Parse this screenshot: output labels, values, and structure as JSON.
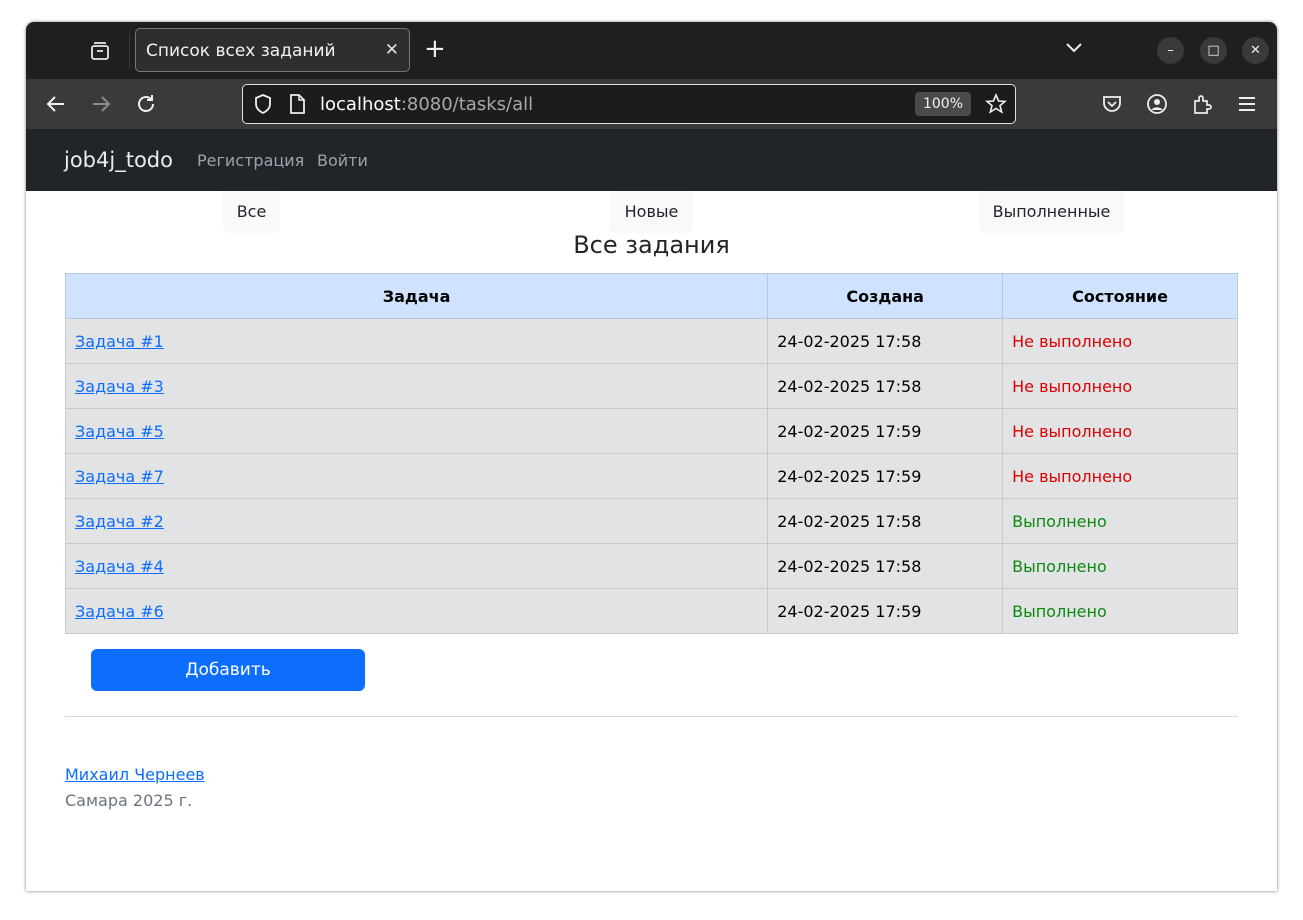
{
  "browser": {
    "tab_title": "Список всех заданий",
    "tab_close": "✕",
    "new_tab": "+",
    "url_host": "localhost",
    "url_rest": ":8080/tasks/all",
    "zoom": "100%",
    "window_controls": {
      "minimize": "–",
      "maximize": "□",
      "close": "✕"
    }
  },
  "navbar": {
    "brand": "job4j_todo",
    "links": [
      "Регистрация",
      "Войти"
    ]
  },
  "filters": [
    "Все",
    "Новые",
    "Выполненные"
  ],
  "page_title": "Все задания",
  "table": {
    "headers": [
      "Задача",
      "Создана",
      "Состояние"
    ],
    "rows": [
      {
        "name": "Задача #1",
        "created": "24-02-2025 17:58",
        "status": "Не выполнено"
      },
      {
        "name": "Задача #3",
        "created": "24-02-2025 17:58",
        "status": "Не выполнено"
      },
      {
        "name": "Задача #5",
        "created": "24-02-2025 17:59",
        "status": "Не выполнено"
      },
      {
        "name": "Задача #7",
        "created": "24-02-2025 17:59",
        "status": "Не выполнено"
      },
      {
        "name": "Задача #2",
        "created": "24-02-2025 17:58",
        "status": "Выполнено"
      },
      {
        "name": "Задача #4",
        "created": "24-02-2025 17:58",
        "status": "Выполнено"
      },
      {
        "name": "Задача #6",
        "created": "24-02-2025 17:59",
        "status": "Выполнено"
      }
    ]
  },
  "add_button": "Добавить",
  "footer": {
    "author": "Михаил Чернеев",
    "place": "Самара 2025 г."
  },
  "colors": {
    "status_not_done": "#dc0000",
    "status_done": "#0d8a0d",
    "primary": "#0d6efd",
    "header_bg": "#cfe2ff"
  }
}
